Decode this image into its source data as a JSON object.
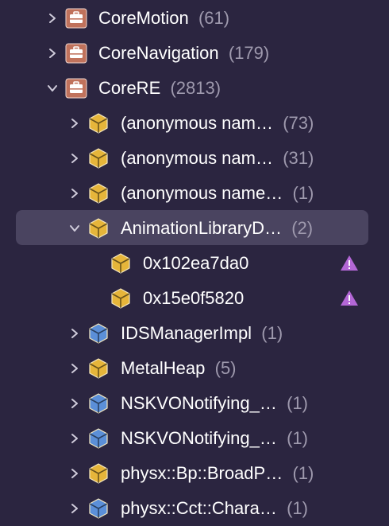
{
  "colors": {
    "background": "#2b2540",
    "selection": "#4a4460",
    "count_text": "#9f9aae",
    "toolbox_icon": "#c0725c",
    "package_icon_yellow": "#e6b53a",
    "package_icon_blue": "#5b8fd8",
    "warning_icon": "#b367d6"
  },
  "rows": [
    {
      "name": "CoreMotion",
      "count": "(61)",
      "icon": "toolbox-icon",
      "expanded": false
    },
    {
      "name": "CoreNavigation",
      "count": "(179)",
      "icon": "toolbox-icon",
      "expanded": false
    },
    {
      "name": "CoreRE",
      "count": "(2813)",
      "icon": "toolbox-icon",
      "expanded": true
    },
    {
      "name": "(anonymous nam…",
      "count": "(73)",
      "icon": "package-icon-yellow",
      "expanded": false
    },
    {
      "name": "(anonymous nam…",
      "count": "(31)",
      "icon": "package-icon-yellow",
      "expanded": false
    },
    {
      "name": "(anonymous name…",
      "count": "(1)",
      "icon": "package-icon-yellow",
      "expanded": false
    },
    {
      "name": "AnimationLibraryD…",
      "count": "(2)",
      "icon": "package-icon-yellow",
      "expanded": true,
      "selected": true
    },
    {
      "name": "0x102ea7da0",
      "count": "",
      "icon": "package-icon-yellow",
      "warning": true
    },
    {
      "name": "0x15e0f5820",
      "count": "",
      "icon": "package-icon-yellow",
      "warning": true
    },
    {
      "name": "IDSManagerImpl",
      "count": "(1)",
      "icon": "package-icon-blue",
      "expanded": false
    },
    {
      "name": "MetalHeap",
      "count": "(5)",
      "icon": "package-icon-yellow",
      "expanded": false
    },
    {
      "name": "NSKVONotifying_…",
      "count": "(1)",
      "icon": "package-icon-blue",
      "expanded": false
    },
    {
      "name": "NSKVONotifying_…",
      "count": "(1)",
      "icon": "package-icon-blue",
      "expanded": false
    },
    {
      "name": "physx::Bp::BroadP…",
      "count": "(1)",
      "icon": "package-icon-yellow",
      "expanded": false
    },
    {
      "name": "physx::Cct::Chara…",
      "count": "(1)",
      "icon": "package-icon-blue",
      "expanded": false
    }
  ]
}
